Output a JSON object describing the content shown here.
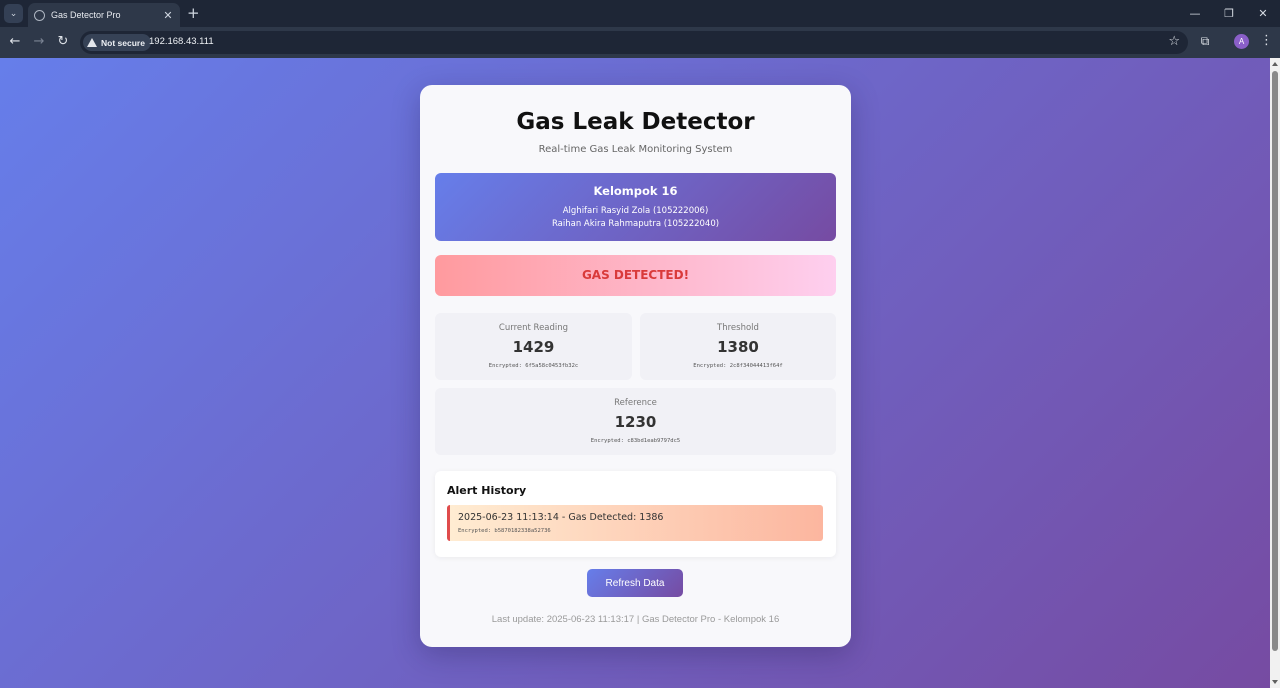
{
  "browser": {
    "tab_title": "Gas Detector Pro",
    "tab_close_icon": "✕",
    "new_tab_icon": "+",
    "security_label": "Not secure",
    "url": "192.168.43.111",
    "icons": {
      "tab_search": "⌄",
      "back": "←",
      "forward": "→",
      "reload": "↻",
      "bookmark": "☆",
      "extensions": "⧉",
      "menu": "⋮",
      "minimize": "—",
      "maximize": "❐",
      "close": "✕"
    },
    "profile_initial": "A"
  },
  "page": {
    "title": "Gas Leak Detector",
    "subtitle": "Real-time Gas Leak Monitoring System",
    "group": {
      "name": "Kelompok 16",
      "members": [
        "Alghifari Rasyid Zola (105222006)",
        "Raihan Akira Rahmaputra (105222040)"
      ]
    },
    "status": "GAS DETECTED!",
    "metrics": {
      "current": {
        "label": "Current Reading",
        "value": "1429",
        "encrypted": "Encrypted: 6f5a58c0453fb32c"
      },
      "threshold": {
        "label": "Threshold",
        "value": "1380",
        "encrypted": "Encrypted: 2c8f34044413f64f"
      },
      "reference": {
        "label": "Reference",
        "value": "1230",
        "encrypted": "Encrypted: c83bd1eab9797dc5"
      }
    },
    "history": {
      "title": "Alert History",
      "items": [
        {
          "text": "2025-06-23 11:13:14 - Gas Detected: 1386",
          "encrypted": "Encrypted: b5870182338a52736"
        }
      ]
    },
    "refresh_label": "Refresh Data",
    "footer": "Last update: 2025-06-23 11:13:17 | Gas Detector Pro - Kelompok 16"
  },
  "colors": {
    "gradient_start": "#667eea",
    "gradient_end": "#764ba2",
    "alert_red": "#d93a3a"
  }
}
